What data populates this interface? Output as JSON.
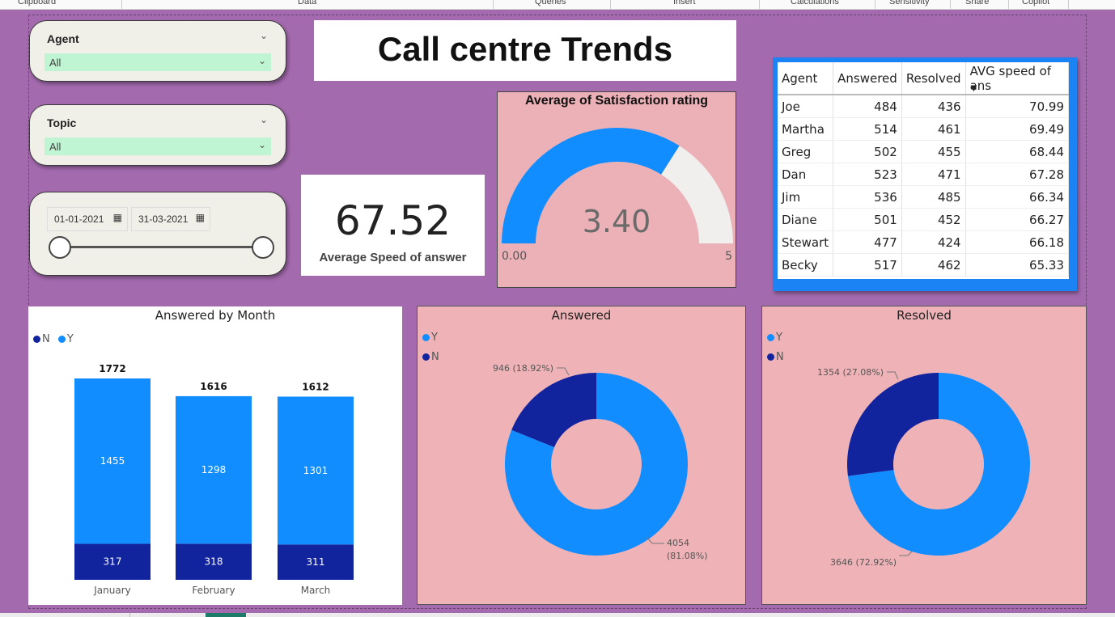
{
  "ribbon": {
    "groups": [
      "Clipboard",
      "Data",
      "Queries",
      "Insert",
      "Calculations",
      "Sensitivity",
      "Share",
      "Copilot"
    ]
  },
  "colors": {
    "canvas": "#a36aad",
    "y_blue": "#118dff",
    "n_navy": "#12239e",
    "card_pink": "#ebb1b7",
    "donut_panel": "#efb3b7",
    "gauge_remainder": "#f0efed",
    "slicer_dropdown": "#bff5d2"
  },
  "slicers": {
    "agent": {
      "label": "Agent",
      "value": "All"
    },
    "topic": {
      "label": "Topic",
      "value": "All"
    },
    "date": {
      "start": "01-01-2021",
      "end": "31-03-2021"
    }
  },
  "title": "Call centre Trends",
  "kpi": {
    "value": "67.52",
    "label": "Average Speed of answer"
  },
  "gauge": {
    "title": "Average of Satisfaction rating",
    "value": "3.40",
    "value_num": 3.4,
    "min": "0.00",
    "max": "5",
    "max_num": 5
  },
  "agent_table": {
    "headers": [
      "Agent",
      "Answered",
      "Resolved",
      "AVG speed of ans"
    ],
    "rows": [
      [
        "Joe",
        "484",
        "436",
        "70.99"
      ],
      [
        "Martha",
        "514",
        "461",
        "69.49"
      ],
      [
        "Greg",
        "502",
        "455",
        "68.44"
      ],
      [
        "Dan",
        "523",
        "471",
        "67.28"
      ],
      [
        "Jim",
        "536",
        "485",
        "66.34"
      ],
      [
        "Diane",
        "501",
        "452",
        "66.27"
      ],
      [
        "Stewart",
        "477",
        "424",
        "66.18"
      ],
      [
        "Becky",
        "517",
        "462",
        "65.33"
      ]
    ]
  },
  "chart_data": [
    {
      "type": "bar",
      "stacked": true,
      "title": "Answered by Month",
      "categories": [
        "January",
        "February",
        "March"
      ],
      "series": [
        {
          "name": "N",
          "values": [
            317,
            318,
            311
          ]
        },
        {
          "name": "Y",
          "values": [
            1455,
            1298,
            1301
          ]
        }
      ],
      "totals": [
        1772,
        1616,
        1612
      ],
      "legend": [
        "N",
        "Y"
      ],
      "legend_position": "top-left"
    },
    {
      "type": "pie",
      "donut": true,
      "title": "Answered",
      "series": [
        {
          "name": "Y",
          "value": 4054,
          "label": "4054 (81.08%)"
        },
        {
          "name": "N",
          "value": 946,
          "label": "946 (18.92%)"
        }
      ],
      "legend": [
        "Y",
        "N"
      ],
      "legend_position": "top-left"
    },
    {
      "type": "pie",
      "donut": true,
      "title": "Resolved",
      "series": [
        {
          "name": "Y",
          "value": 3646,
          "label": "3646 (72.92%)"
        },
        {
          "name": "N",
          "value": 1354,
          "label": "1354 (27.08%)"
        }
      ],
      "legend": [
        "Y",
        "N"
      ],
      "legend_position": "top-left"
    }
  ]
}
